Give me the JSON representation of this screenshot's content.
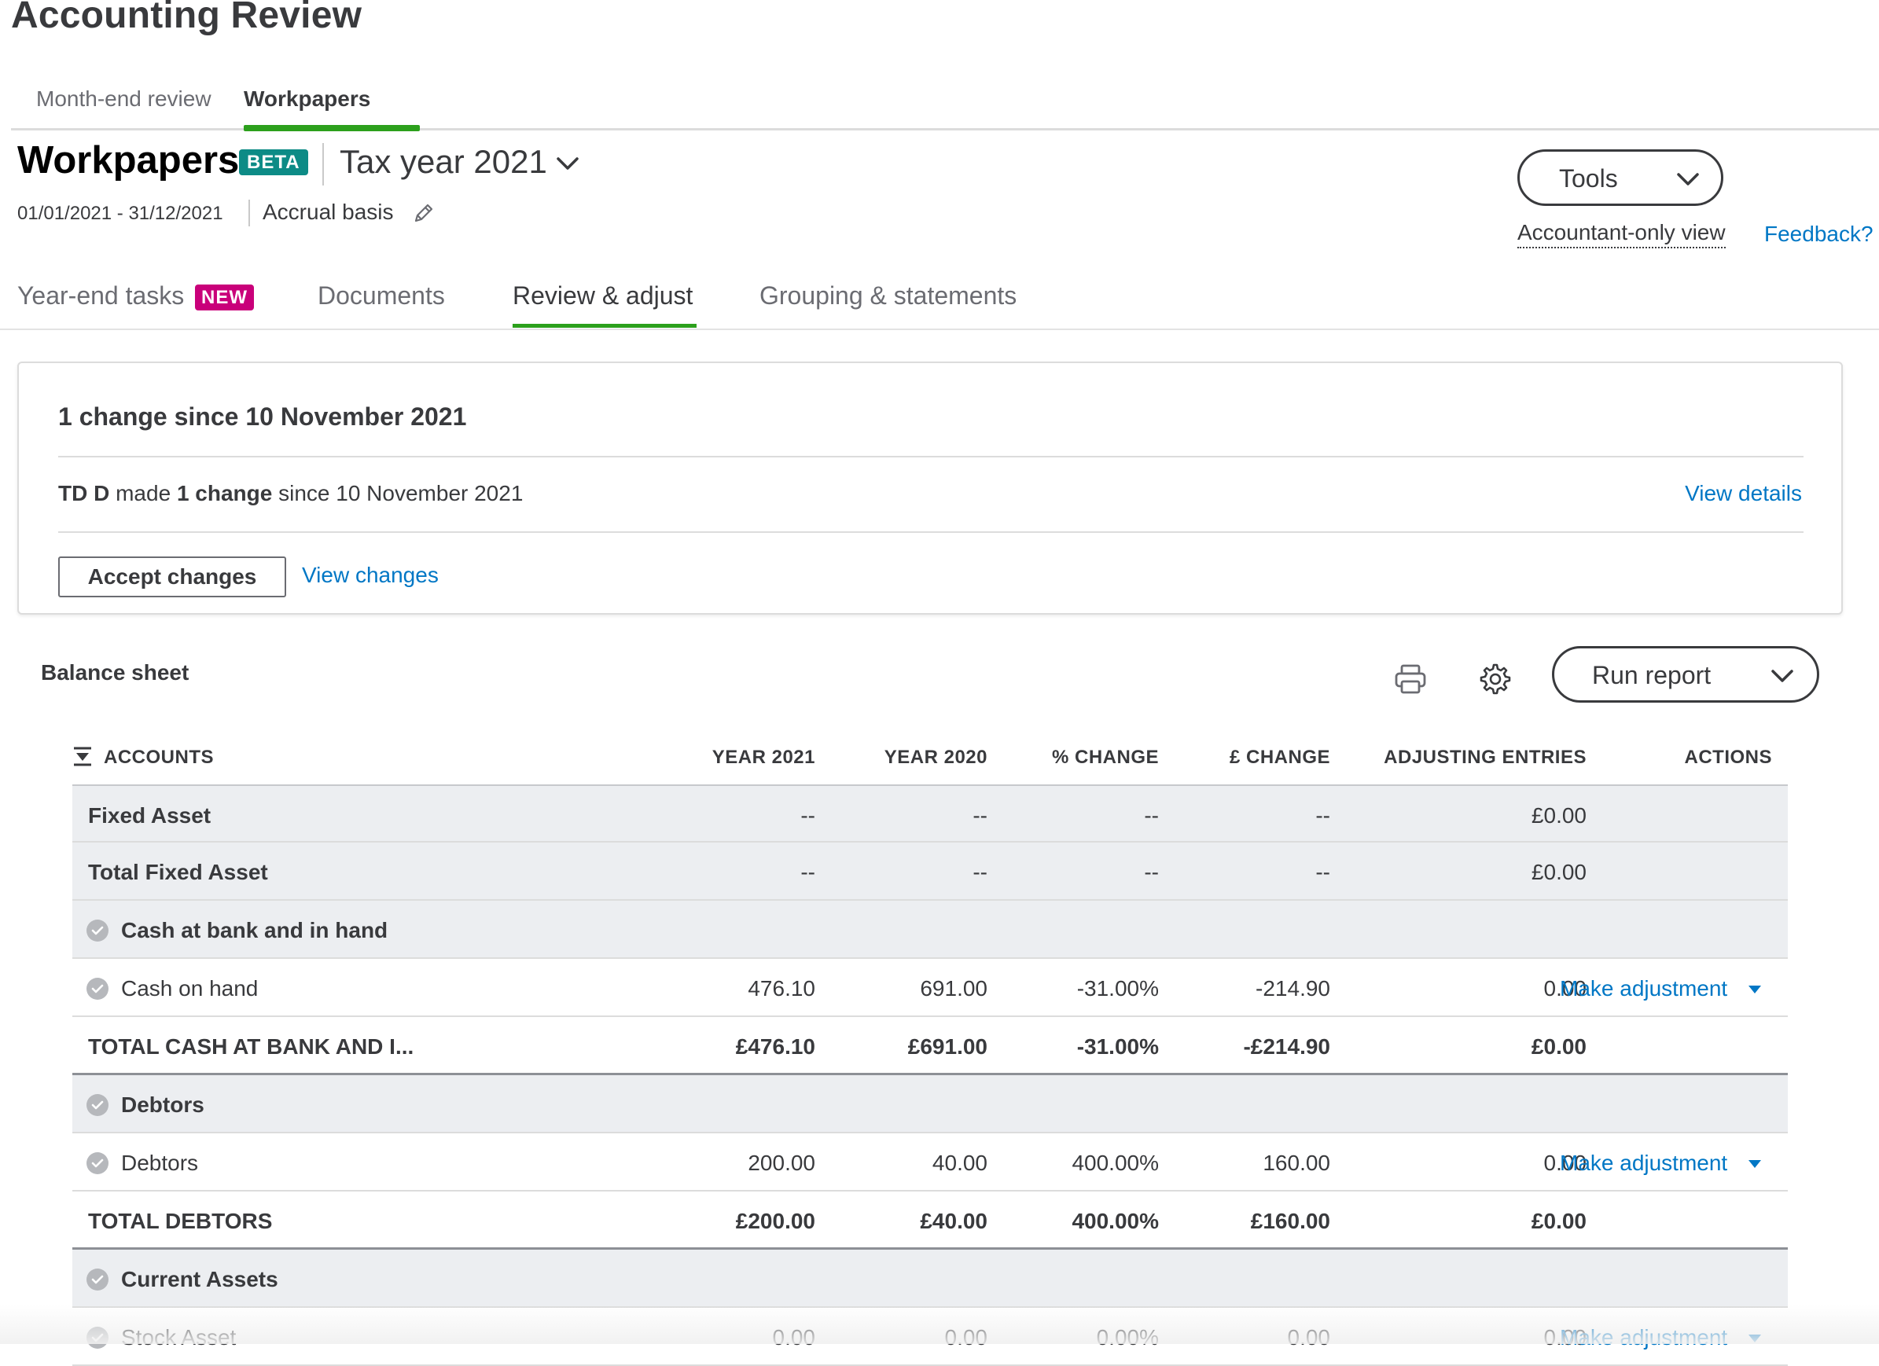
{
  "app_title": "Accounting Review",
  "top_tabs": [
    {
      "label": "Month-end review",
      "active": false
    },
    {
      "label": "Workpapers",
      "active": true
    }
  ],
  "header": {
    "title": "Workpapers",
    "badge": "BETA",
    "tax_year": "Tax year 2021",
    "period": "01/01/2021 - 31/12/2021",
    "basis": "Accrual basis",
    "tools_label": "Tools",
    "accountant_view": "Accountant-only view",
    "feedback": "Feedback?"
  },
  "sub_tabs": [
    {
      "label": "Year-end tasks",
      "badge": "NEW",
      "active": false
    },
    {
      "label": "Documents",
      "active": false
    },
    {
      "label": "Review & adjust",
      "active": true
    },
    {
      "label": "Grouping & statements",
      "active": false
    }
  ],
  "changes_card": {
    "title": "1 change since 10 November 2021",
    "user": "TD D",
    "made": " made ",
    "change_count": "1 change",
    "since": " since 10 November 2021",
    "view_details": "View details",
    "accept_label": "Accept changes",
    "view_changes": "View changes"
  },
  "balance_sheet": {
    "title": "Balance sheet",
    "run_report_label": "Run report",
    "columns": [
      "ACCOUNTS",
      "YEAR 2021",
      "YEAR 2020",
      "% CHANGE",
      "£ CHANGE",
      "ADJUSTING ENTRIES",
      "ACTIONS"
    ],
    "rows": [
      {
        "account": "Fixed Asset",
        "y2021": "--",
        "y2020": "--",
        "pct": "--",
        "chg": "--",
        "adj": "£0.00",
        "action": ""
      },
      {
        "account": "Total Fixed Asset",
        "y2021": "--",
        "y2020": "--",
        "pct": "--",
        "chg": "--",
        "adj": "£0.00",
        "action": ""
      },
      {
        "account": "Cash at bank and in hand",
        "y2021": "",
        "y2020": "",
        "pct": "",
        "chg": "",
        "adj": "",
        "action": ""
      },
      {
        "account": "Cash on hand",
        "y2021": "476.10",
        "y2020": "691.00",
        "pct": "-31.00%",
        "chg": "-214.90",
        "adj": "0.00",
        "action": "Make adjustment"
      },
      {
        "account": "TOTAL CASH AT BANK AND I...",
        "y2021": "£476.10",
        "y2020": "£691.00",
        "pct": "-31.00%",
        "chg": "-£214.90",
        "adj": "£0.00",
        "action": ""
      },
      {
        "account": "Debtors",
        "y2021": "",
        "y2020": "",
        "pct": "",
        "chg": "",
        "adj": "",
        "action": ""
      },
      {
        "account": "Debtors",
        "y2021": "200.00",
        "y2020": "40.00",
        "pct": "400.00%",
        "chg": "160.00",
        "adj": "0.00",
        "action": "Make adjustment"
      },
      {
        "account": "TOTAL DEBTORS",
        "y2021": "£200.00",
        "y2020": "£40.00",
        "pct": "400.00%",
        "chg": "£160.00",
        "adj": "£0.00",
        "action": ""
      },
      {
        "account": "Current Assets",
        "y2021": "",
        "y2020": "",
        "pct": "",
        "chg": "",
        "adj": "",
        "action": ""
      },
      {
        "account": "Stock Asset",
        "y2021": "0.00",
        "y2020": "0.00",
        "pct": "0.00%",
        "chg": "0.00",
        "adj": "0.00",
        "action": "Make adjustment"
      }
    ]
  },
  "colors": {
    "accent_green": "#2ca01c",
    "link_blue": "#0077c5",
    "beta_teal": "#0d8b86",
    "new_magenta": "#c9007a",
    "group_row_grey": "#eceef1"
  },
  "icons": [
    "chevron-down-icon",
    "pencil-icon",
    "print-icon",
    "gear-icon",
    "sort-icon",
    "status-dot-icon",
    "caret-down-icon"
  ]
}
